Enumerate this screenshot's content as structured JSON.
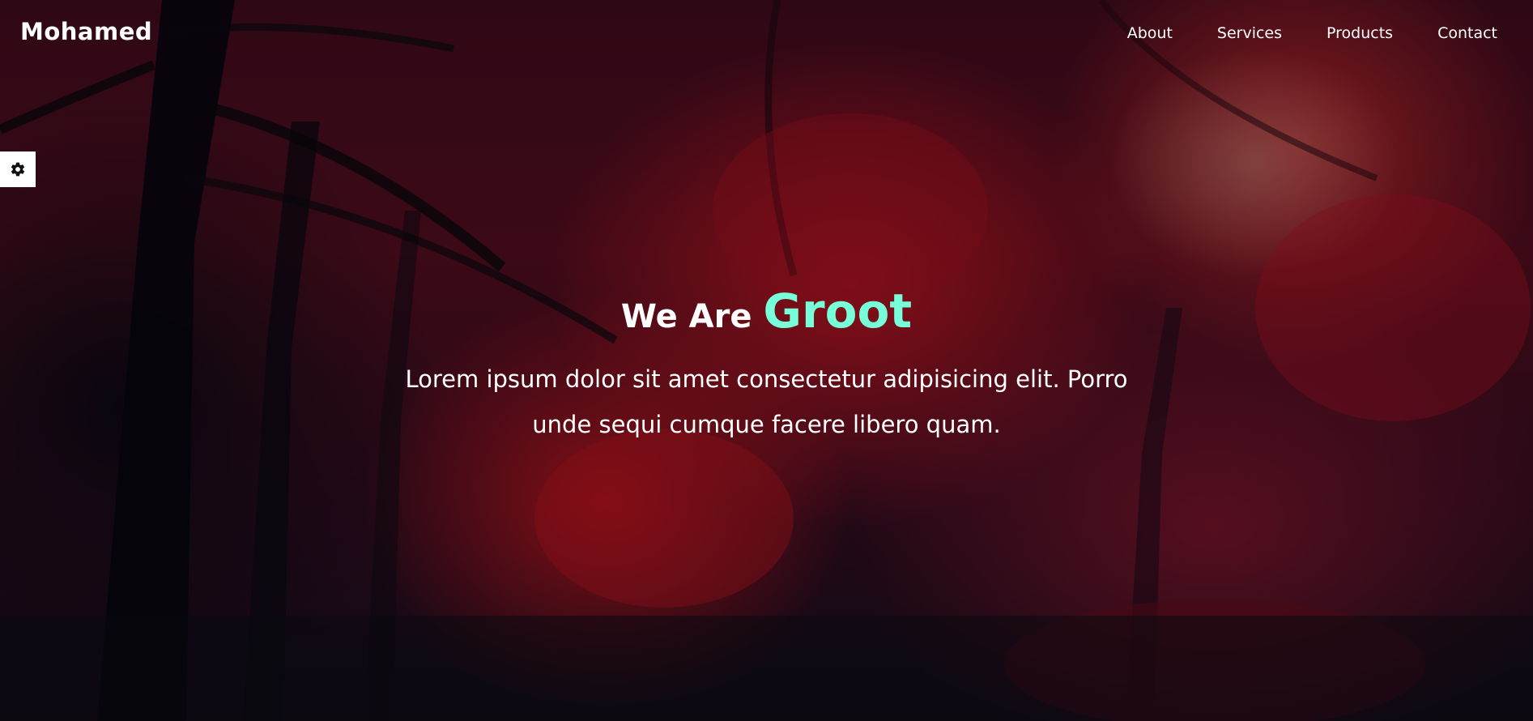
{
  "brand": {
    "name": "Mohamed"
  },
  "nav": {
    "items": [
      {
        "label": "About"
      },
      {
        "label": "Services"
      },
      {
        "label": "Products"
      },
      {
        "label": "Contact"
      }
    ]
  },
  "settings": {
    "icon": "gear-icon"
  },
  "hero": {
    "title_prefix": "We Are",
    "title_highlight": "Groot",
    "paragraph": "Lorem ipsum dolor sit amet consectetur adipisicing elit. Porro unde sequi cumque facere libero quam."
  },
  "colors": {
    "accent": "#76ffd8",
    "text": "#ffffff"
  }
}
